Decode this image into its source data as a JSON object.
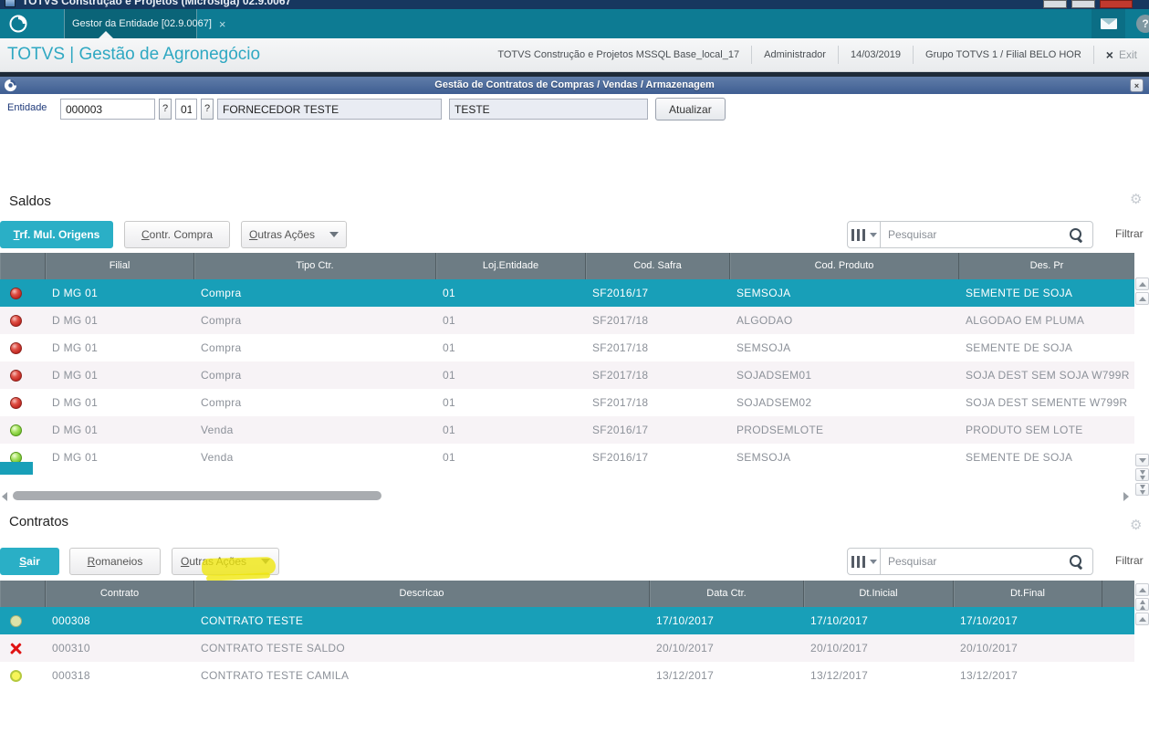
{
  "window": {
    "title": "TOTVS Construção e Projetos (Microsiga) 02.9.0067"
  },
  "tabbar": {
    "tab_label": "Gestor da Entidade [02.9.0067]",
    "tab_close": "×",
    "help": "?"
  },
  "header": {
    "brand": "TOTVS | Gestão de Agronegócio",
    "environment": "TOTVS Construção e Projetos MSSQL Base_local_17",
    "user": "Administrador",
    "date": "14/03/2019",
    "group": "Grupo TOTVS 1 / Filial BELO HOR",
    "exit_x": "×",
    "exit_label": "Exit"
  },
  "panel": {
    "title": "Gestão de Contratos de Compras / Vendas / Armazenagem",
    "close": "×",
    "entity_label": "Entidade",
    "entity_code": "000003",
    "lookup": "?",
    "store": "01",
    "name": "FORNECEDOR TESTE",
    "short_name": "TESTE",
    "refresh_label": "Atualizar"
  },
  "saldos": {
    "title": "Saldos",
    "buttons": {
      "primary": "Trf. Mul. Origens",
      "secondary": "Contr. Compra",
      "more": "Outras Ações"
    },
    "search": {
      "placeholder": "Pesquisar",
      "filter": "Filtrar"
    },
    "columns": [
      "",
      "Filial",
      "Tipo Ctr.",
      "Loj.Entidade",
      "Cod. Safra",
      "Cod. Produto",
      "Des. Pr"
    ],
    "rows": [
      {
        "status": "red",
        "selected": true,
        "cells": [
          "D MG 01",
          "Compra",
          "01",
          "SF2016/17",
          "SEMSOJA",
          "SEMENTE DE SOJA"
        ]
      },
      {
        "status": "red",
        "selected": false,
        "cells": [
          "D MG 01",
          "Compra",
          "01",
          "SF2017/18",
          "ALGODAO",
          "ALGODAO EM PLUMA"
        ]
      },
      {
        "status": "red",
        "selected": false,
        "cells": [
          "D MG 01",
          "Compra",
          "01",
          "SF2017/18",
          "SEMSOJA",
          "SEMENTE DE SOJA"
        ]
      },
      {
        "status": "red",
        "selected": false,
        "cells": [
          "D MG 01",
          "Compra",
          "01",
          "SF2017/18",
          "SOJADSEM01",
          "SOJA DEST SEM SOJA W799R"
        ]
      },
      {
        "status": "red",
        "selected": false,
        "cells": [
          "D MG 01",
          "Compra",
          "01",
          "SF2017/18",
          "SOJADSEM02",
          "SOJA DEST SEMENTE W799R"
        ]
      },
      {
        "status": "green",
        "selected": false,
        "cells": [
          "D MG 01",
          "Venda",
          "01",
          "SF2016/17",
          "PRODSEMLOTE",
          "PRODUTO SEM LOTE"
        ]
      },
      {
        "status": "green",
        "selected": false,
        "cells": [
          "D MG 01",
          "Venda",
          "01",
          "SF2016/17",
          "SEMSOJA",
          "SEMENTE DE SOJA"
        ]
      }
    ]
  },
  "contratos": {
    "title": "Contratos",
    "buttons": {
      "primary": "Sair",
      "secondary": "Romaneios",
      "more": "Outras Ações"
    },
    "search": {
      "placeholder": "Pesquisar",
      "filter": "Filtrar"
    },
    "columns": [
      "",
      "Contrato",
      "Descricao",
      "Data Ctr.",
      "Dt.Inicial",
      "Dt.Final",
      ""
    ],
    "rows": [
      {
        "status": "olive",
        "selected": true,
        "cells": [
          "000308",
          "CONTRATO TESTE",
          "17/10/2017",
          "17/10/2017",
          "17/10/2017"
        ]
      },
      {
        "status": "red-x",
        "selected": false,
        "cells": [
          "000310",
          "CONTRATO TESTE SALDO",
          "20/10/2017",
          "20/10/2017",
          "20/10/2017"
        ]
      },
      {
        "status": "yellow",
        "selected": false,
        "cells": [
          "000318",
          "CONTRATO TESTE CAMILA",
          "13/12/2017",
          "13/12/2017",
          "13/12/2017"
        ]
      }
    ]
  },
  "annotation": {
    "highlighted_text": "Outras Ações",
    "highlight_color": "#f0e70a"
  },
  "colors": {
    "tabbar_teal": "#0d7b93",
    "brand_teal": "#2fa8c2",
    "button_teal": "#2aafc6",
    "selected_row_teal": "#189fb8",
    "grid_header_gray": "#6d7c84",
    "alt_row": "#f7f3f6",
    "panelbar_blue": "#4a6796",
    "status_red": "#bb1f1a",
    "status_green": "#66bb22",
    "status_yellow": "#f7f558"
  }
}
